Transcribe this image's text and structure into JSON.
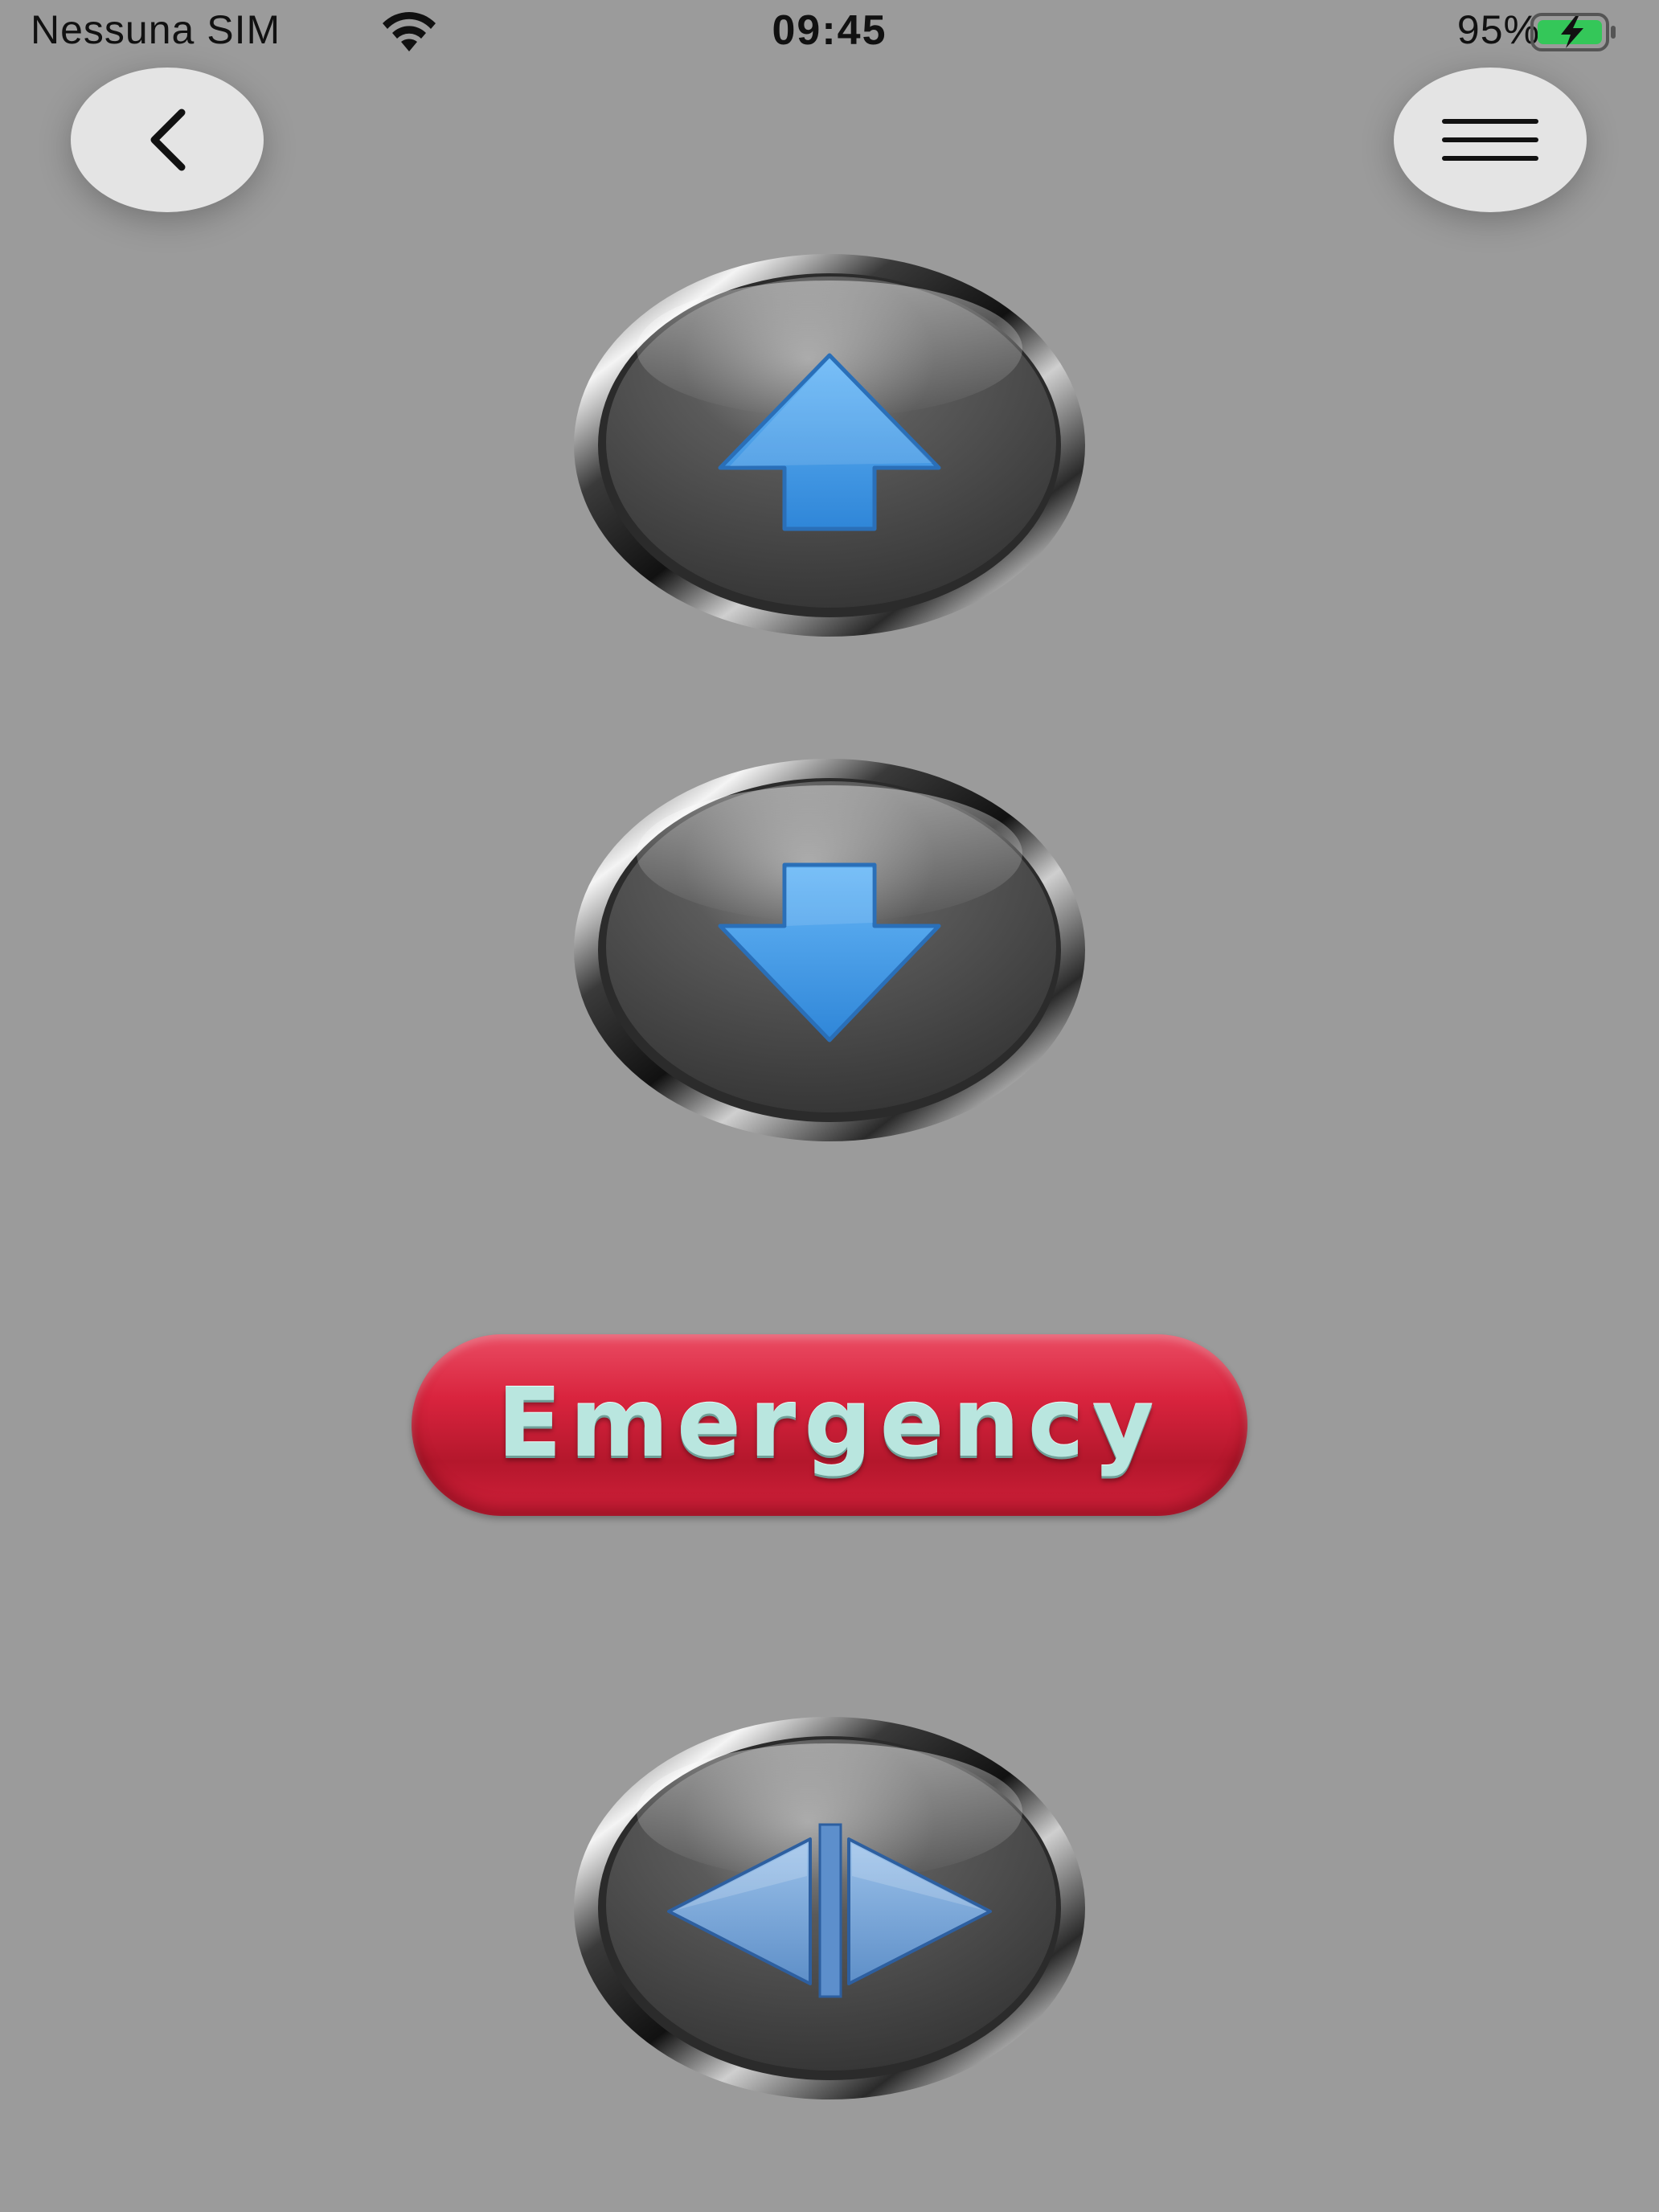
{
  "status_bar": {
    "carrier": "Nessuna SIM",
    "time": "09:45",
    "battery_percent": "95%",
    "battery_level": 0.95,
    "battery_charging": true,
    "icons": [
      "wifi-icon",
      "battery-charging-icon"
    ]
  },
  "nav": {
    "back_icon": "chevron-left-icon",
    "menu_icon": "hamburger-menu-icon"
  },
  "controls": {
    "up_icon": "arrow-up-icon",
    "down_icon": "arrow-down-icon",
    "emergency_label": "Emergency",
    "doors_icon": "door-open-icon"
  },
  "colors": {
    "background": "#9b9b9b",
    "arrow_blue": "#4a9be6",
    "emergency_red": "#d9243e",
    "emergency_text": "#b9e6df",
    "nav_button": "#e4e4e4"
  }
}
